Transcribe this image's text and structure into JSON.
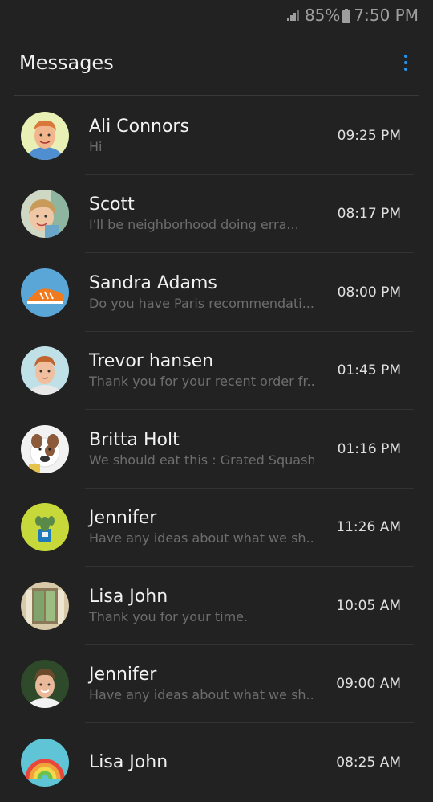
{
  "status_bar": {
    "battery": "85%",
    "time": "7:50 PM",
    "icons": [
      "signal-icon",
      "battery-icon"
    ]
  },
  "header": {
    "title": "Messages",
    "menu_icon": "more-vert-icon",
    "accent_color": "#2196f3"
  },
  "conversations": [
    {
      "name": "Ali Connors",
      "preview": "Hi",
      "time": "09:25 PM",
      "avatar": "avatar-ali-connors"
    },
    {
      "name": "Scott",
      "preview": "I'll be neighborhood doing erra...",
      "time": "08:17 PM",
      "avatar": "avatar-scott"
    },
    {
      "name": "Sandra Adams",
      "preview": "Do you have Paris recommendati...",
      "time": "08:00 PM",
      "avatar": "avatar-sandra-adams"
    },
    {
      "name": "Trevor hansen",
      "preview": "Thank you for your recent order fr...",
      "time": "01:45 PM",
      "avatar": "avatar-trevor-hansen"
    },
    {
      "name": "Britta Holt",
      "preview": "We should eat this : Grated Squash,",
      "time": "01:16 PM",
      "avatar": "avatar-britta-holt"
    },
    {
      "name": "Jennifer",
      "preview": "Have any ideas about what we sh...",
      "time": "11:26 AM",
      "avatar": "avatar-jennifer"
    },
    {
      "name": "Lisa John",
      "preview": "Thank you for your time.",
      "time": "10:05 AM",
      "avatar": "avatar-lisa-john"
    },
    {
      "name": "Jennifer",
      "preview": "Have any ideas about what we sh...",
      "time": "09:00 AM",
      "avatar": "avatar-jennifer-2"
    },
    {
      "name": "Lisa John",
      "preview": "",
      "time": "08:25 AM",
      "avatar": "avatar-lisa-john-2"
    }
  ]
}
